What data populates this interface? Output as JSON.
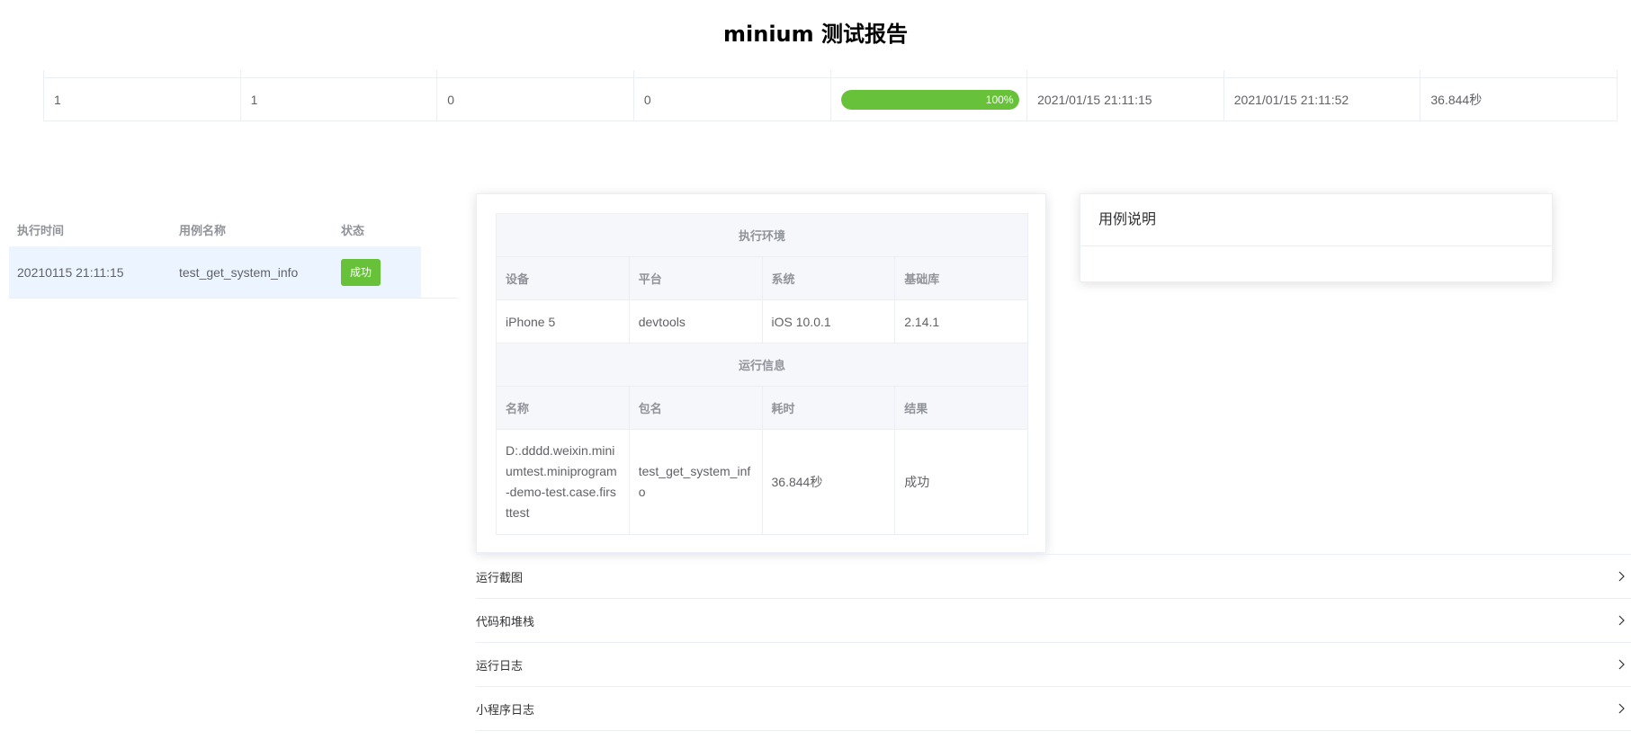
{
  "title": "minium 测试报告",
  "summary": {
    "cells": [
      "1",
      "1",
      "0",
      "0"
    ],
    "progress": {
      "percent": 100,
      "label": "100%"
    },
    "start_time": "2021/01/15 21:11:15",
    "end_time": "2021/01/15 21:11:52",
    "duration": "36.844秒"
  },
  "colors": {
    "success": "#67c23a",
    "row_highlight": "#ecf5ff",
    "header_bg": "#f5f7fa"
  },
  "case_list": {
    "headers": {
      "time": "执行时间",
      "name": "用例名称",
      "status": "状态"
    },
    "rows": [
      {
        "time": "20210115 21:11:15",
        "name": "test_get_system_info",
        "status": "成功"
      }
    ]
  },
  "env": {
    "section_title": "执行环境",
    "headers": [
      "设备",
      "平台",
      "系统",
      "基础库"
    ],
    "values": [
      "iPhone 5",
      "devtools",
      "iOS 10.0.1",
      "2.14.1"
    ]
  },
  "run": {
    "section_title": "运行信息",
    "headers": [
      "名称",
      "包名",
      "耗时",
      "结果"
    ],
    "values": [
      "D:.dddd.weixin.miniumtest.miniprogram-demo-test.case.firsttest",
      "test_get_system_info",
      "36.844秒",
      "成功"
    ]
  },
  "description": {
    "title": "用例说明"
  },
  "collapse": [
    {
      "label": "运行截图",
      "icon": "chevron-right-icon"
    },
    {
      "label": "代码和堆栈",
      "icon": "chevron-right-icon"
    },
    {
      "label": "运行日志",
      "icon": "chevron-right-icon"
    },
    {
      "label": "小程序日志",
      "icon": "chevron-right-icon"
    }
  ]
}
